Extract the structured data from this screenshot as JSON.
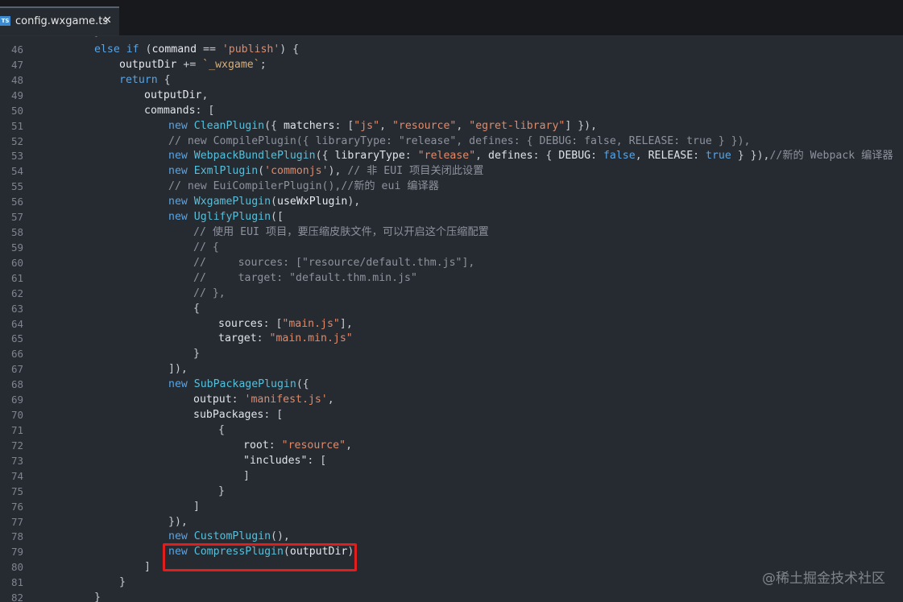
{
  "tab": {
    "icon_label": "TS",
    "filename": "config.wxgame.ts",
    "close_glyph": "✕"
  },
  "editor": {
    "lines": [
      {
        "n": 46,
        "tokens": [
          [
            "kw",
            "else "
          ],
          [
            "kw",
            "if "
          ],
          [
            "pun",
            "("
          ],
          [
            "id",
            "command"
          ],
          [
            "pun",
            " == "
          ],
          [
            "str",
            "'publish'"
          ],
          [
            "pun",
            ") {"
          ]
        ]
      },
      {
        "n": 47,
        "tokens": [
          [
            "id",
            "outputDir"
          ],
          [
            "pun",
            " += "
          ],
          [
            "tpl",
            "`_wxgame`"
          ],
          [
            "pun",
            ";"
          ]
        ]
      },
      {
        "n": 48,
        "tokens": [
          [
            "kw",
            "return "
          ],
          [
            "pun",
            "{"
          ]
        ]
      },
      {
        "n": 49,
        "tokens": [
          [
            "id",
            "outputDir"
          ],
          [
            "pun",
            ","
          ]
        ]
      },
      {
        "n": 50,
        "tokens": [
          [
            "prop",
            "commands"
          ],
          [
            "pun",
            ": ["
          ]
        ]
      },
      {
        "n": 51,
        "tokens": [
          [
            "kw",
            "new "
          ],
          [
            "func",
            "CleanPlugin"
          ],
          [
            "pun",
            "({ "
          ],
          [
            "prop",
            "matchers"
          ],
          [
            "pun",
            ": ["
          ],
          [
            "str",
            "\"js\""
          ],
          [
            "pun",
            ", "
          ],
          [
            "str",
            "\"resource\""
          ],
          [
            "pun",
            ", "
          ],
          [
            "str",
            "\"egret-library\""
          ],
          [
            "pun",
            "] }),"
          ]
        ]
      },
      {
        "n": 52,
        "tokens": [
          [
            "com",
            "// new CompilePlugin({ libraryType: \"release\", defines: { DEBUG: false, RELEASE: true } }),"
          ]
        ]
      },
      {
        "n": 53,
        "tokens": [
          [
            "kw",
            "new "
          ],
          [
            "func",
            "WebpackBundlePlugin"
          ],
          [
            "pun",
            "({ "
          ],
          [
            "prop",
            "libraryType"
          ],
          [
            "pun",
            ": "
          ],
          [
            "str",
            "\"release\""
          ],
          [
            "pun",
            ", "
          ],
          [
            "prop",
            "defines"
          ],
          [
            "pun",
            ": { "
          ],
          [
            "prop",
            "DEBUG"
          ],
          [
            "pun",
            ": "
          ],
          [
            "bool",
            "false"
          ],
          [
            "pun",
            ", "
          ],
          [
            "prop",
            "RELEASE"
          ],
          [
            "pun",
            ": "
          ],
          [
            "bool",
            "true"
          ],
          [
            "pun",
            " } }),"
          ],
          [
            "com",
            "//新的 Webpack 编译器"
          ]
        ]
      },
      {
        "n": 54,
        "tokens": [
          [
            "kw",
            "new "
          ],
          [
            "func",
            "ExmlPlugin"
          ],
          [
            "pun",
            "("
          ],
          [
            "str",
            "'commonjs'"
          ],
          [
            "pun",
            "), "
          ],
          [
            "com",
            "// 非 EUI 项目关闭此设置"
          ]
        ]
      },
      {
        "n": 55,
        "tokens": [
          [
            "com",
            "// new EuiCompilerPlugin(),//新的 eui 编译器"
          ]
        ]
      },
      {
        "n": 56,
        "tokens": [
          [
            "kw",
            "new "
          ],
          [
            "func",
            "WxgamePlugin"
          ],
          [
            "pun",
            "("
          ],
          [
            "id",
            "useWxPlugin"
          ],
          [
            "pun",
            "),"
          ]
        ]
      },
      {
        "n": 57,
        "tokens": [
          [
            "kw",
            "new "
          ],
          [
            "func",
            "UglifyPlugin"
          ],
          [
            "pun",
            "(["
          ]
        ]
      },
      {
        "n": 58,
        "tokens": [
          [
            "com",
            "// 使用 EUI 项目，要压缩皮肤文件，可以开启这个压缩配置"
          ]
        ]
      },
      {
        "n": 59,
        "tokens": [
          [
            "com",
            "// {"
          ]
        ]
      },
      {
        "n": 60,
        "tokens": [
          [
            "com",
            "//     sources: [\"resource/default.thm.js\"],"
          ]
        ]
      },
      {
        "n": 61,
        "tokens": [
          [
            "com",
            "//     target: \"default.thm.min.js\""
          ]
        ]
      },
      {
        "n": 62,
        "tokens": [
          [
            "com",
            "// },"
          ]
        ]
      },
      {
        "n": 63,
        "tokens": [
          [
            "pun",
            "{"
          ]
        ]
      },
      {
        "n": 64,
        "tokens": [
          [
            "prop",
            "sources"
          ],
          [
            "pun",
            ": ["
          ],
          [
            "str",
            "\"main.js\""
          ],
          [
            "pun",
            "],"
          ]
        ]
      },
      {
        "n": 65,
        "tokens": [
          [
            "prop",
            "target"
          ],
          [
            "pun",
            ": "
          ],
          [
            "str",
            "\"main.min.js\""
          ]
        ]
      },
      {
        "n": 66,
        "tokens": [
          [
            "pun",
            "}"
          ]
        ]
      },
      {
        "n": 67,
        "tokens": [
          [
            "pun",
            "]),"
          ]
        ]
      },
      {
        "n": 68,
        "tokens": [
          [
            "kw",
            "new "
          ],
          [
            "func",
            "SubPackagePlugin"
          ],
          [
            "pun",
            "({"
          ]
        ]
      },
      {
        "n": 69,
        "tokens": [
          [
            "prop",
            "output"
          ],
          [
            "pun",
            ": "
          ],
          [
            "str",
            "'manifest.js'"
          ],
          [
            "pun",
            ","
          ]
        ]
      },
      {
        "n": 70,
        "tokens": [
          [
            "prop",
            "subPackages"
          ],
          [
            "pun",
            ": ["
          ]
        ]
      },
      {
        "n": 71,
        "tokens": [
          [
            "pun",
            "{"
          ]
        ]
      },
      {
        "n": 72,
        "tokens": [
          [
            "prop",
            "root"
          ],
          [
            "pun",
            ": "
          ],
          [
            "str",
            "\"resource\""
          ],
          [
            "pun",
            ","
          ]
        ]
      },
      {
        "n": 73,
        "tokens": [
          [
            "prop",
            "\"includes\""
          ],
          [
            "pun",
            ": ["
          ]
        ]
      },
      {
        "n": 74,
        "tokens": [
          [
            "pun",
            "]"
          ]
        ]
      },
      {
        "n": 75,
        "tokens": [
          [
            "pun",
            "}"
          ]
        ]
      },
      {
        "n": 76,
        "tokens": [
          [
            "pun",
            "]"
          ]
        ]
      },
      {
        "n": 77,
        "tokens": [
          [
            "pun",
            "}),"
          ]
        ]
      },
      {
        "n": 78,
        "tokens": [
          [
            "kw",
            "new "
          ],
          [
            "func",
            "CustomPlugin"
          ],
          [
            "pun",
            "(),"
          ]
        ]
      },
      {
        "n": 79,
        "tokens": [
          [
            "kw",
            "new "
          ],
          [
            "func",
            "CompressPlugin"
          ],
          [
            "pun",
            "("
          ],
          [
            "id",
            "outputDir"
          ],
          [
            "pun",
            ")"
          ]
        ]
      },
      {
        "n": 80,
        "tokens": [
          [
            "pun",
            "]"
          ]
        ]
      },
      {
        "n": 81,
        "tokens": [
          [
            "pun",
            "}"
          ]
        ]
      },
      {
        "n": 82,
        "tokens": [
          [
            "pun",
            "}"
          ]
        ]
      }
    ]
  },
  "watermark": "@稀土掘金技术社区",
  "colors": {
    "highlight_box": "#e01e1e",
    "editor_bg": "#262a31"
  }
}
